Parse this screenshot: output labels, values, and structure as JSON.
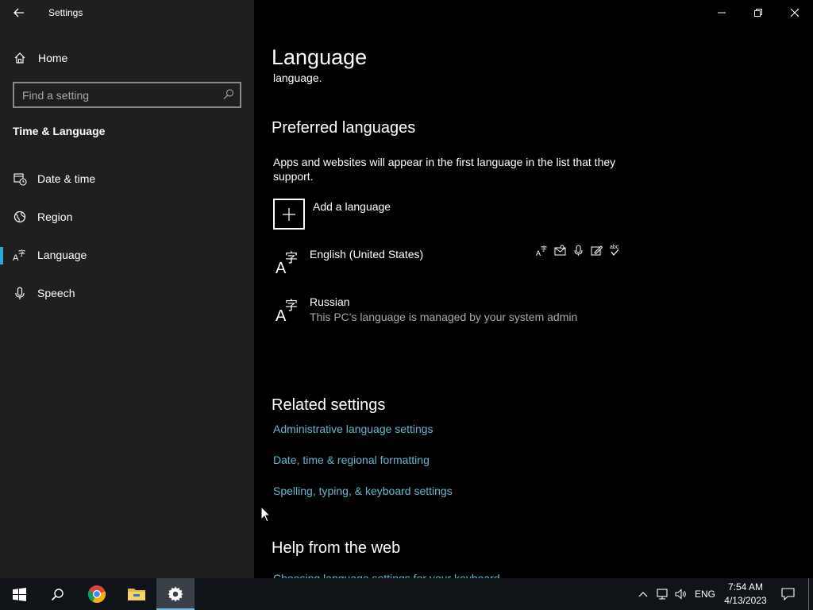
{
  "window": {
    "app_title": "Settings"
  },
  "sidebar": {
    "home_label": "Home",
    "search_placeholder": "Find a setting",
    "section_title": "Time & Language",
    "items": [
      {
        "label": "Date & time",
        "icon": "date-time-icon"
      },
      {
        "label": "Region",
        "icon": "region-icon"
      },
      {
        "label": "Language",
        "icon": "language-icon",
        "selected": true
      },
      {
        "label": "Speech",
        "icon": "microphone-icon"
      }
    ]
  },
  "main": {
    "page_title": "Language",
    "cut_text": "language.",
    "preferred": {
      "heading": "Preferred languages",
      "description": "Apps and websites will appear in the first language in the list that they support.",
      "add_label": "Add a language",
      "languages": [
        {
          "name": "English (United States)",
          "subtitle": ""
        },
        {
          "name": "Russian",
          "subtitle": "This PC's language is managed by your system admin"
        }
      ]
    },
    "related": {
      "heading": "Related settings",
      "links": [
        "Administrative language settings",
        "Date, time & regional formatting",
        "Spelling, typing, & keyboard settings"
      ]
    },
    "help": {
      "heading": "Help from the web",
      "links": [
        "Choosing language settings for your keyboard"
      ]
    }
  },
  "taskbar": {
    "lang_indicator": "ENG",
    "time": "7:54 AM",
    "date": "4/13/2023"
  },
  "colors": {
    "sidebar_bg": "#1f1f1f",
    "accent": "#2aa9d6",
    "link": "#63b8cc",
    "taskbar_bg": "#101418"
  }
}
